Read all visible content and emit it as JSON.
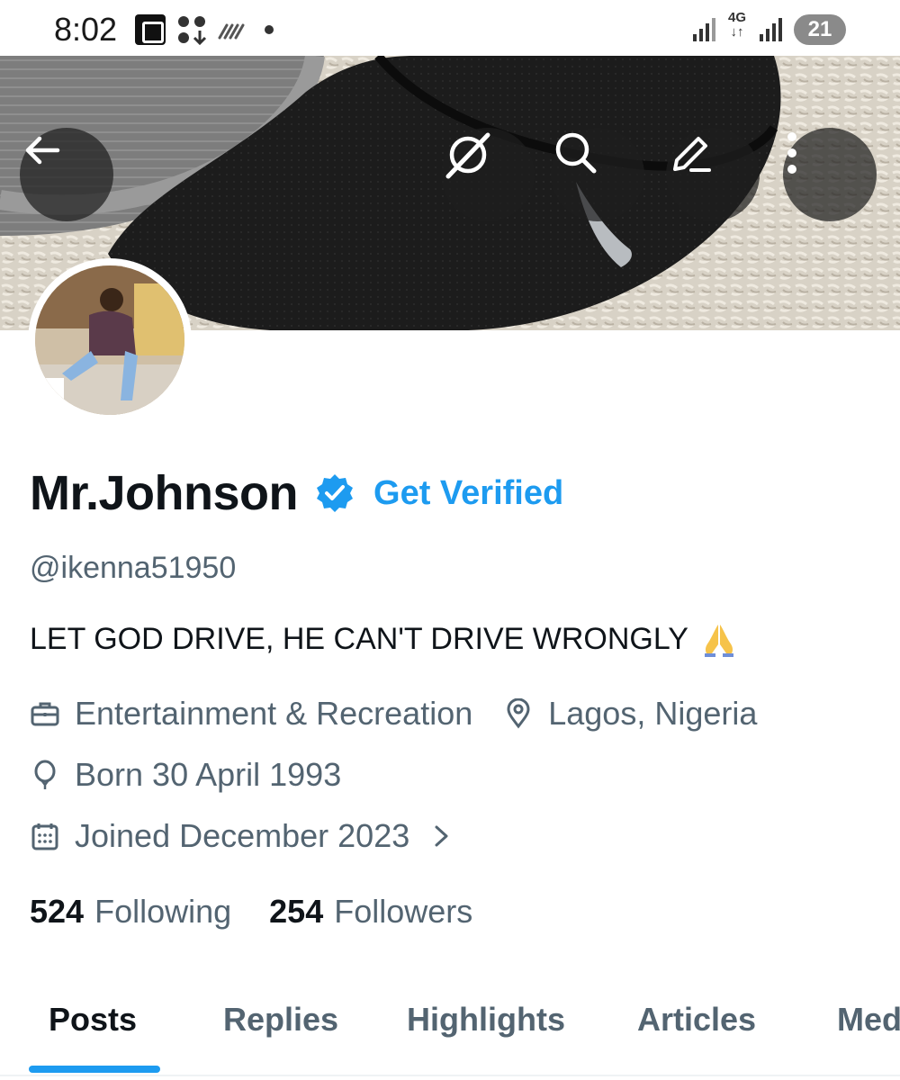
{
  "status_bar": {
    "time": "8:02",
    "network": "4G",
    "battery": "21"
  },
  "header": {
    "back_icon": "arrow-left-icon",
    "grok_icon": "grok-icon",
    "search_icon": "search-icon",
    "edit_icon": "pencil-icon",
    "more_icon": "more-vertical-icon"
  },
  "profile": {
    "display_name": "Mr.Johnson",
    "verified_icon": "verified-badge-icon",
    "get_verified_label": "Get Verified",
    "handle": "@ikenna51950",
    "bio": "LET GOD DRIVE, HE CAN'T DRIVE WRONGLY",
    "bio_emoji": "folded-hands-emoji",
    "category": "Entertainment & Recreation",
    "location": "Lagos, Nigeria",
    "birthday": "Born 30 April 1993",
    "joined": "Joined December 2023",
    "following_count": "524",
    "following_label": "Following",
    "followers_count": "254",
    "followers_label": "Followers"
  },
  "tabs": [
    {
      "label": "Posts",
      "active": true
    },
    {
      "label": "Replies",
      "active": false
    },
    {
      "label": "Highlights",
      "active": false
    },
    {
      "label": "Articles",
      "active": false
    },
    {
      "label": "Media",
      "active": false
    }
  ],
  "colors": {
    "accent": "#1d9bf0",
    "text_primary": "#0f1419",
    "text_secondary": "#536471"
  }
}
